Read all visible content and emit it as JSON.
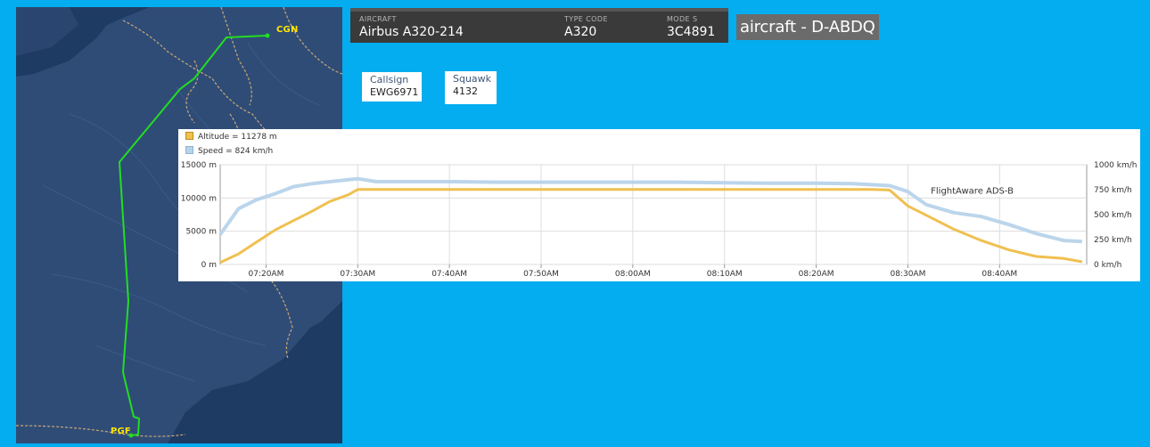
{
  "map": {
    "origin_code": "CGN",
    "destination_code": "PGF",
    "colors": {
      "water": "#1e3b63",
      "land": "#2f4c77",
      "route": "#22dd22",
      "border": "#c9a876",
      "airport_label": "#ffe600"
    }
  },
  "aircraft": {
    "fields": [
      {
        "label": "AIRCRAFT",
        "value": "Airbus A320-214"
      },
      {
        "label": "TYPE CODE",
        "value": "A320"
      },
      {
        "label": "MODE S",
        "value": "3C4891"
      }
    ],
    "title": "aircraft - D-ABDQ"
  },
  "callsign": {
    "label": "Callsign",
    "value": "EWG6971"
  },
  "squawk": {
    "label": "Squawk",
    "value": "4132"
  },
  "chart_data": {
    "type": "line",
    "x": [
      "07:15",
      "07:17",
      "07:19",
      "07:21",
      "07:23",
      "07:25",
      "07:27",
      "07:29",
      "07:30",
      "07:32",
      "07:35",
      "07:40",
      "07:45",
      "07:50",
      "07:55",
      "08:00",
      "08:05",
      "08:10",
      "08:15",
      "08:20",
      "08:24",
      "08:26",
      "08:28",
      "08:30",
      "08:32",
      "08:35",
      "08:38",
      "08:41",
      "08:44",
      "08:47",
      "08:49"
    ],
    "x_tick_labels": [
      "07:20AM",
      "07:30AM",
      "07:40AM",
      "07:50AM",
      "08:00AM",
      "08:10AM",
      "08:20AM",
      "08:30AM",
      "08:40AM"
    ],
    "x_tick_minutes": [
      20,
      30,
      40,
      50,
      60,
      70,
      80,
      90,
      100
    ],
    "x_range_minutes": [
      15,
      109.5
    ],
    "series": [
      {
        "name": "Altitude = 11278 m",
        "axis": "left",
        "color": "#f0c050",
        "values": [
          300,
          1600,
          3400,
          5200,
          6600,
          8000,
          9500,
          10500,
          11278,
          11278,
          11278,
          11278,
          11278,
          11278,
          11278,
          11278,
          11278,
          11278,
          11278,
          11278,
          11278,
          11278,
          11200,
          8800,
          7400,
          5300,
          3600,
          2200,
          1200,
          900,
          400
        ]
      },
      {
        "name": "Speed = 824 km/h",
        "axis": "right",
        "color": "#b7d3ea",
        "values": [
          300,
          560,
          650,
          710,
          780,
          810,
          830,
          850,
          860,
          830,
          830,
          830,
          825,
          825,
          825,
          825,
          825,
          820,
          815,
          815,
          810,
          800,
          790,
          730,
          600,
          520,
          480,
          400,
          310,
          240,
          230
        ]
      }
    ],
    "left_axis": {
      "ticks": [
        "0 m",
        "5000 m",
        "10000 m",
        "15000 m"
      ],
      "ylim": [
        0,
        15000
      ]
    },
    "right_axis": {
      "ticks": [
        "0 km/h",
        "250 km/h",
        "500 km/h",
        "750 km/h",
        "1000 km/h"
      ],
      "ylim": [
        0,
        1000
      ]
    },
    "annotation": "FlightAware ADS-B",
    "grid": true,
    "legend": "top-left"
  }
}
